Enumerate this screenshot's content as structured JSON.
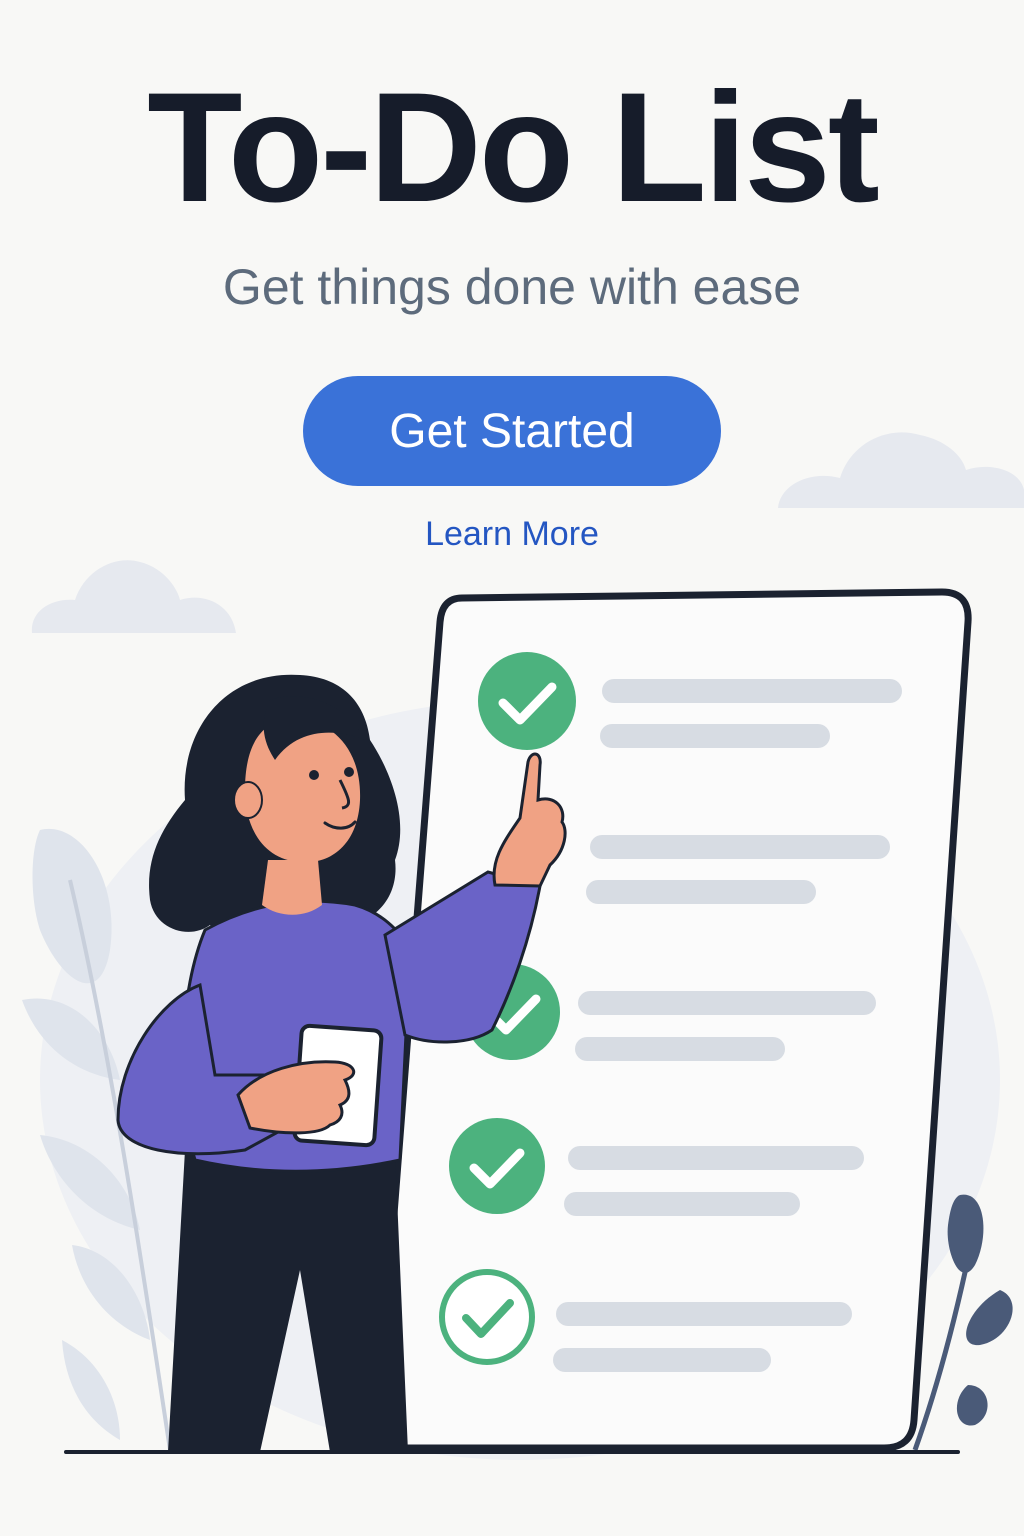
{
  "hero": {
    "title": "To-Do List",
    "subtitle": "Get things done with ease",
    "primary_button": "Get Started",
    "secondary_link": "Learn More"
  },
  "illustration": {
    "tasks": [
      {
        "status": "done"
      },
      {
        "status": "pending"
      },
      {
        "status": "done"
      },
      {
        "status": "done"
      },
      {
        "status": "done-outline"
      }
    ]
  },
  "colors": {
    "background": "#f8f8f6",
    "accent": "#3a72d8",
    "link": "#2456c2",
    "check": "#4cb27e",
    "shirt": "#6a63c7",
    "dark": "#1b2230"
  }
}
